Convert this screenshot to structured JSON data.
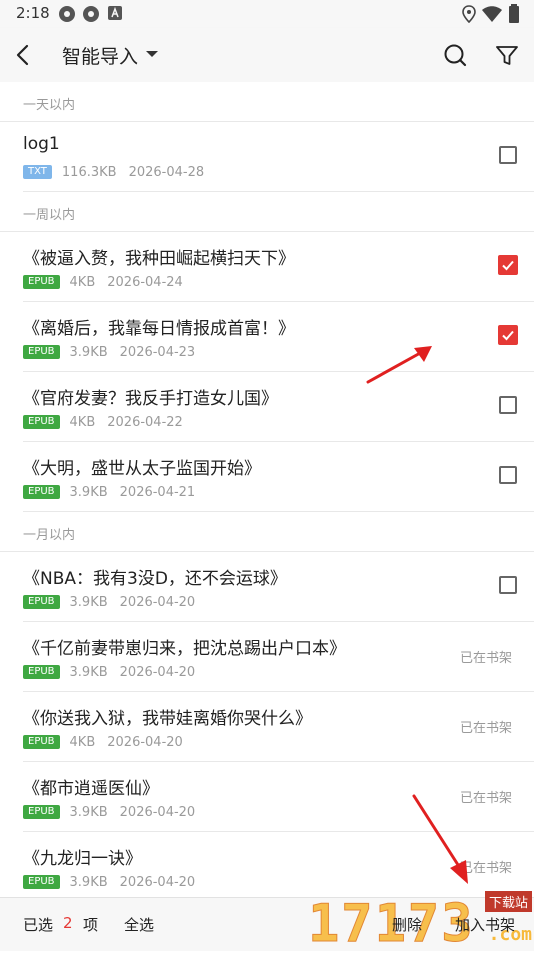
{
  "status_bar": {
    "time": "2:18"
  },
  "header": {
    "title": "智能导入"
  },
  "sections": [
    {
      "label": "一天以内"
    },
    {
      "label": "一周以内"
    },
    {
      "label": "一月以内"
    }
  ],
  "files": [
    {
      "name": "log1",
      "type": "TXT",
      "size": "116.3KB",
      "date": "2026-04-28",
      "checked": false
    },
    {
      "name": "《被逼入赘，我种田崛起横扫天下》",
      "type": "EPUB",
      "size": "4KB",
      "date": "2026-04-24",
      "checked": true
    },
    {
      "name": "《离婚后，我靠每日情报成首富！》",
      "type": "EPUB",
      "size": "3.9KB",
      "date": "2026-04-23",
      "checked": true
    },
    {
      "name": "《官府发妻？我反手打造女儿国》",
      "type": "EPUB",
      "size": "4KB",
      "date": "2026-04-22",
      "checked": false
    },
    {
      "name": "《大明，盛世从太子监国开始》",
      "type": "EPUB",
      "size": "3.9KB",
      "date": "2026-04-21",
      "checked": false
    },
    {
      "name": "《NBA：我有3没D，还不会运球》",
      "type": "EPUB",
      "size": "3.9KB",
      "date": "2026-04-20",
      "checked": false
    },
    {
      "name": "《千亿前妻带崽归来，把沈总踢出户口本》",
      "type": "EPUB",
      "size": "3.9KB",
      "date": "2026-04-20",
      "status": "已在书架"
    },
    {
      "name": "《你送我入狱，我带娃离婚你哭什么》",
      "type": "EPUB",
      "size": "4KB",
      "date": "2026-04-20",
      "status": "已在书架"
    },
    {
      "name": "《都市逍遥医仙》",
      "type": "EPUB",
      "size": "3.9KB",
      "date": "2026-04-20",
      "status": "已在书架"
    },
    {
      "name": "《九龙归一诀》",
      "type": "EPUB",
      "size": "3.9KB",
      "date": "2026-04-20",
      "status": "已在书架"
    }
  ],
  "bottom_bar": {
    "selected_prefix": "已选",
    "selected_count": "2",
    "selected_suffix": "项",
    "select_all": "全选",
    "delete": "删除",
    "add_to_shelf": "加入书架"
  },
  "watermark": {
    "number": "17173",
    "tag": "下载站",
    "domain": ".com"
  },
  "colors": {
    "accent": "#e53935",
    "txt_badge": "#7fb6ea",
    "epub_badge": "#3fa842",
    "annotation_arrow": "#e02020"
  }
}
